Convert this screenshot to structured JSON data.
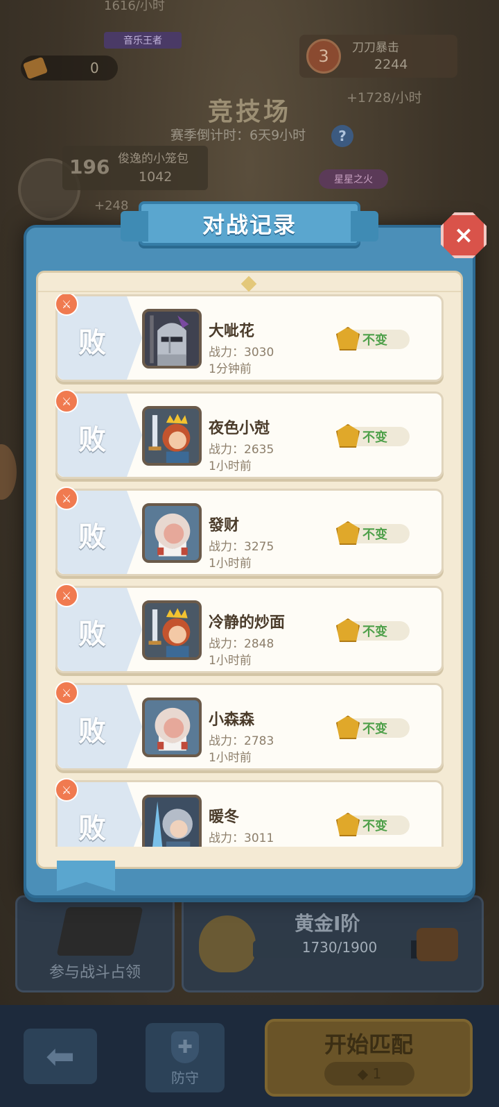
{
  "background": {
    "top_stat": "1616/小时",
    "music_tag": "音乐王者",
    "ticket_count": "0",
    "rank_card": {
      "rank": "3",
      "name": "刀刀暴击",
      "score": "2244"
    },
    "income_right": "+1728/小时",
    "title": "竞技场",
    "season": "赛季倒计时：6天9小时",
    "help_icon": "?",
    "player": {
      "rank": "196",
      "name": "俊逸的小笼包",
      "score": "1042"
    },
    "income_left": "+248",
    "star_tag": "星星之火",
    "occupy_label": "参与战斗占领",
    "rank_panel": {
      "tier": "黄金I阶",
      "progress": "1730/1900",
      "current": 1730,
      "max": 1900
    },
    "defend_label": "防守",
    "match_label": "开始匹配",
    "match_cost": "1"
  },
  "modal": {
    "title": "对战记录",
    "close_icon": "×"
  },
  "records": [
    {
      "result": "败",
      "name": "大呲花",
      "power": "战力：3030",
      "time": "1分钟前",
      "change": "不变",
      "avatar": "knight"
    },
    {
      "result": "败",
      "name": "夜色小尅",
      "power": "战力：2635",
      "time": "1小时前",
      "change": "不变",
      "avatar": "princess"
    },
    {
      "result": "败",
      "name": "發财",
      "power": "战力：3275",
      "time": "1小时前",
      "change": "不变",
      "avatar": "elder"
    },
    {
      "result": "败",
      "name": "冷静的炒面",
      "power": "战力：2848",
      "time": "1小时前",
      "change": "不变",
      "avatar": "princess"
    },
    {
      "result": "败",
      "name": "小森森",
      "power": "战力：2783",
      "time": "1小时前",
      "change": "不变",
      "avatar": "elder"
    },
    {
      "result": "败",
      "name": "暖冬",
      "power": "战力：3011",
      "time": "",
      "change": "不变",
      "avatar": "ice"
    }
  ],
  "colors": {
    "modal_blue": "#4b8fb8",
    "panel_cream": "#f4ead4",
    "change_green": "#4fa04a",
    "sword_orange": "#f07a50"
  }
}
